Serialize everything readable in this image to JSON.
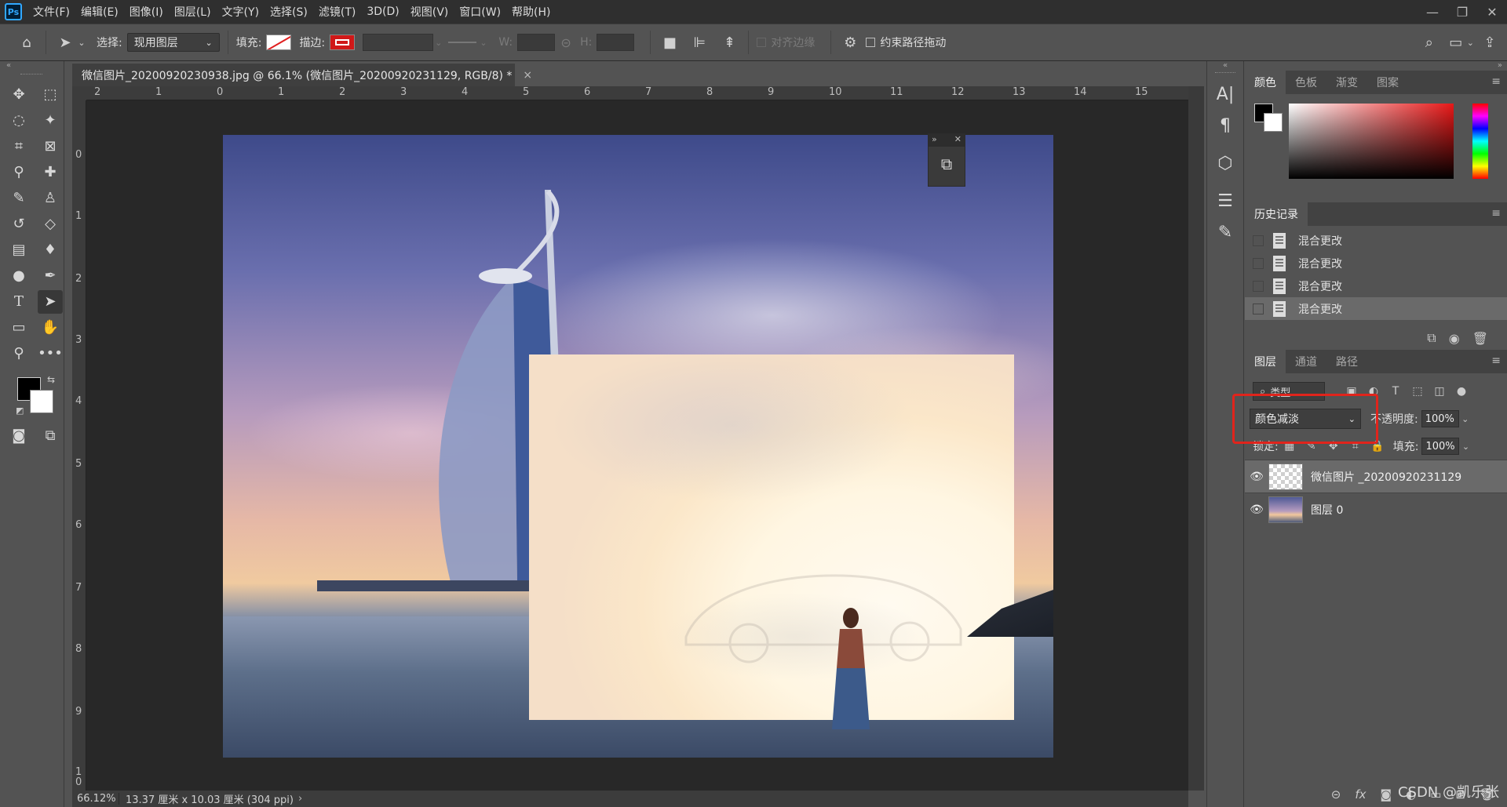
{
  "app": {
    "logo": "Ps"
  },
  "menu": [
    "文件(F)",
    "编辑(E)",
    "图像(I)",
    "图层(L)",
    "文字(Y)",
    "选择(S)",
    "滤镜(T)",
    "3D(D)",
    "视图(V)",
    "窗口(W)",
    "帮助(H)"
  ],
  "options": {
    "select_label": "选择:",
    "select_value": "现用图层",
    "fill_label": "填充:",
    "stroke_label": "描边:",
    "w_label": "W:",
    "h_label": "H:",
    "align_edges": "对齐边缘",
    "constrain_path": "约束路径拖动"
  },
  "document": {
    "tab_title": "微信图片_20200920230938.jpg @ 66.1% (微信图片_20200920231129, RGB/8) *",
    "close_glyph": "×",
    "ruler_top": [
      "2",
      "1",
      "0",
      "1",
      "2",
      "3",
      "4",
      "5",
      "6",
      "7",
      "8",
      "9",
      "10",
      "11",
      "12",
      "13",
      "14",
      "15"
    ],
    "ruler_left": [
      "0",
      "1",
      "2",
      "3",
      "4",
      "5",
      "6",
      "7",
      "8",
      "9",
      "1 0"
    ],
    "status_zoom": "66.12%",
    "status_size": "13.37 厘米 x 10.03 厘米 (304 ppi)"
  },
  "panels": {
    "color_tabs": [
      "颜色",
      "色板",
      "渐变",
      "图案"
    ],
    "history_tab": "历史记录",
    "history_items": [
      "混合更改",
      "混合更改",
      "混合更改",
      "混合更改"
    ],
    "layers_tabs": [
      "图层",
      "通道",
      "路径"
    ],
    "filter_kind": "类型",
    "blend_mode": "颜色减淡",
    "opacity_label": "不透明度:",
    "opacity_value": "100%",
    "lock_label": "锁定:",
    "fill_label": "填充:",
    "fill_value": "100%",
    "layers": [
      {
        "name": "微信图片 _20200920231129",
        "selected": true
      },
      {
        "name": "图层 0",
        "selected": false
      }
    ],
    "footer_fx": "fx"
  },
  "watermark": "CSDN @凯乐张",
  "colors": {
    "accent_highlight": "#e0241c",
    "ps_blue": "#31a8ff",
    "foreground": "#000000",
    "background": "#ffffff"
  }
}
